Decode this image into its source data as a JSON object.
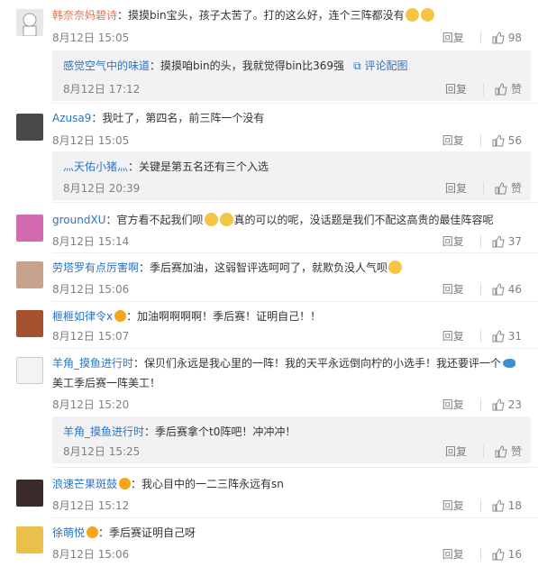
{
  "comments": [
    {
      "user": "韩奈奈妈碧诗",
      "sep": "：",
      "text": "摸摸bin宝头，孩子太苦了。打的这么好，连个三阵都没有",
      "date": "8月12日 15:05",
      "reply": "回复",
      "likes": "98"
    },
    {
      "user": "感觉空气中的味道",
      "sep": "：",
      "text": "摸摸咱bin的头，我就觉得bin比369强",
      "link": "评论配图",
      "date": "8月12日 17:12",
      "reply": "回复",
      "likes": "赞"
    },
    {
      "user": "Azusa9",
      "sep": "：",
      "text": "我吐了，第四名，前三阵一个没有",
      "date": "8月12日 15:05",
      "reply": "回复",
      "likes": "56"
    },
    {
      "user": "灬天佑小猪灬",
      "sep": "：",
      "text": "关键是第五名还有三个入选",
      "date": "8月12日 20:39",
      "reply": "回复",
      "likes": "赞"
    },
    {
      "user": "groundXU",
      "sep": "：",
      "text_a": "官方看不起我们呗",
      "text_b": "真的可以的呢，没话题是我们不配这高贵的最佳阵容呢",
      "date": "8月12日 15:14",
      "reply": "回复",
      "likes": "37"
    },
    {
      "user": "劳塔罗有点厉害啊",
      "sep": "：",
      "text": "季后赛加油，这弱智评选呵呵了，就欺负没人气呗",
      "date": "8月12日 15:06",
      "reply": "回复",
      "likes": "46"
    },
    {
      "user": "榧榧如律令x",
      "sep": "：",
      "text": "加油啊啊啊啊！季后赛！证明自己！！",
      "date": "8月12日 15:07",
      "reply": "回复",
      "likes": "31"
    },
    {
      "user": "羊角_摸鱼进行时",
      "sep": "：",
      "text": "保贝们永远是我心里的一阵！我的天平永远倒向柠的小选手！我还要评一个",
      "text2": "美工季后赛一阵美工！",
      "date": "8月12日 15:20",
      "reply": "回复",
      "likes": "23"
    },
    {
      "user": "羊角_摸鱼进行时",
      "sep": "：",
      "text": "季后赛拿个t0阵吧！冲冲冲！",
      "date": "8月12日 15:25",
      "reply": "回复",
      "likes": "赞"
    },
    {
      "user": "浪速芒果斑鼓",
      "sep": "：",
      "text": "我心目中的一二三阵永远有sn",
      "date": "8月12日 15:12",
      "reply": "回复",
      "likes": "18"
    },
    {
      "user": "徐萌悦",
      "sep": "：",
      "text": "季后赛证明自己呀",
      "date": "8月12日 15:06",
      "reply": "回复",
      "likes": "16"
    }
  ]
}
